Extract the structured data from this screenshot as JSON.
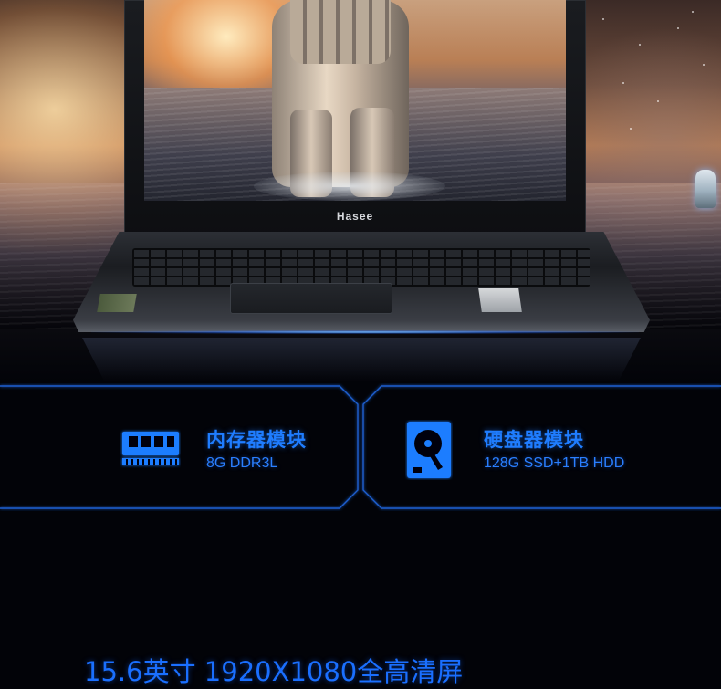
{
  "hero": {
    "brand_logo": "Hasee"
  },
  "specs": [
    {
      "icon": "memory-module-icon",
      "title": "内存器模块",
      "value": "8G DDR3L"
    },
    {
      "icon": "hard-disk-icon",
      "title": "硬盘器模块",
      "value": "128G SSD+1TB HDD"
    }
  ],
  "display": {
    "headline": "15.6英寸 1920X1080全高清屏"
  },
  "colors": {
    "accent_blue": "#1f7dff",
    "frame_blue": "#1a5fd0",
    "background": "#020308"
  }
}
